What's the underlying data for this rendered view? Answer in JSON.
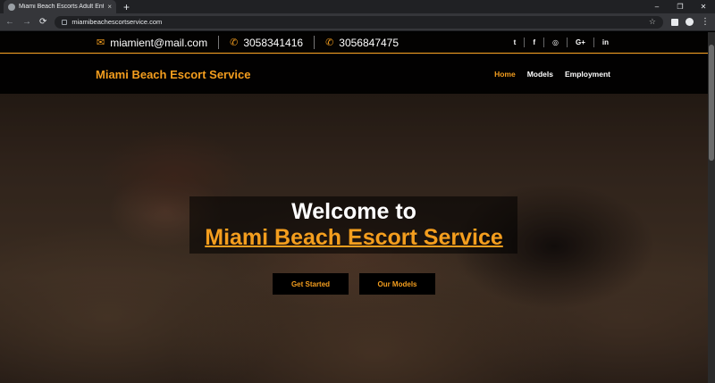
{
  "browser": {
    "tab_title": "Miami Beach Escorts Adult Entert",
    "tab_close": "×",
    "new_tab": "+",
    "url": "miamibeachescortservice.com",
    "window_controls": [
      "–",
      "❐",
      "✕"
    ],
    "nav_icons": [
      "←",
      "→",
      "⟳"
    ],
    "icons": [
      "lock-icon",
      "star-icon",
      "extension-icon",
      "profile-icon",
      "menu-icon"
    ]
  },
  "topbar": {
    "email": "miamient@mail.com",
    "phone1": "3058341416",
    "phone2": "3056847475",
    "social": [
      "t",
      "f",
      "◎",
      "G+",
      "in"
    ]
  },
  "nav": {
    "brand": "Miami Beach Escort Service",
    "links": [
      "Home",
      "Models",
      "Employment"
    ],
    "active": "Home"
  },
  "hero": {
    "welcome": "Welcome to",
    "title": "Miami Beach Escort Service",
    "primary_button": "Get Started",
    "secondary_button": "Our Models"
  },
  "colors": {
    "accent": "#f49e1e",
    "bar_background": "#000000",
    "text": "#ffffff"
  }
}
